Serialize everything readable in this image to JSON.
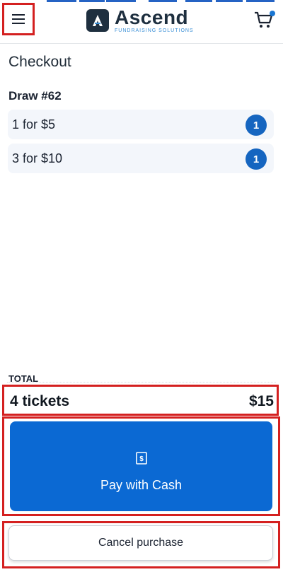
{
  "header": {
    "logo_name": "Ascend",
    "logo_tagline": "FUNDRAISING SOLUTIONS",
    "menu_icon": "hamburger-menu-icon",
    "cart_icon": "shopping-cart-icon"
  },
  "page": {
    "title": "Checkout"
  },
  "draw": {
    "title": "Draw #62",
    "items": [
      {
        "label": "1 for $5",
        "quantity": "1"
      },
      {
        "label": "3 for $10",
        "quantity": "1"
      }
    ]
  },
  "total": {
    "label": "TOTAL",
    "tickets": "4 tickets",
    "amount": "$15"
  },
  "actions": {
    "pay_label": "Pay with Cash",
    "pay_icon": "cash-icon",
    "cancel_label": "Cancel purchase"
  },
  "colors": {
    "primary": "#0b69d3",
    "highlight_border": "#d42020",
    "badge": "#1565c0",
    "item_bg": "#f3f6fb"
  }
}
